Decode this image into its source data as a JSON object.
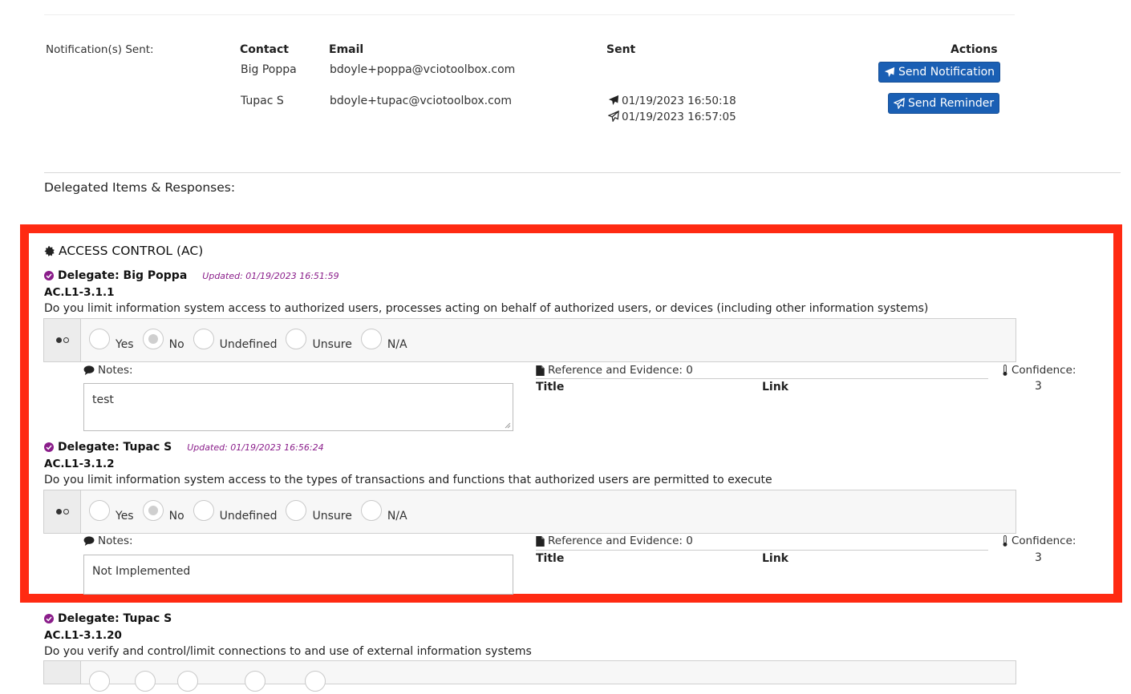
{
  "notifications": {
    "label": "Notification(s) Sent:",
    "headers": {
      "contact": "Contact",
      "email": "Email",
      "sent": "Sent",
      "actions": "Actions"
    },
    "rows": [
      {
        "contact": "Big Poppa",
        "email": "bdoyle+poppa@vciotoolbox.com",
        "sent": [],
        "action": "Send Notification"
      },
      {
        "contact": "Tupac S",
        "email": "bdoyle+tupac@vciotoolbox.com",
        "sent": [
          "01/19/2023 16:50:18",
          "01/19/2023 16:57:05"
        ],
        "action": "Send Reminder"
      }
    ]
  },
  "delegated_title": "Delegated Items & Responses:",
  "category": "ACCESS CONTROL (AC)",
  "options": [
    "Yes",
    "No",
    "Undefined",
    "Unsure",
    "N/A"
  ],
  "labels": {
    "notes": "Notes:",
    "reference": "Reference and Evidence: 0",
    "title_col": "Title",
    "link_col": "Link",
    "confidence": "Confidence:"
  },
  "items": [
    {
      "delegate": "Delegate: Big Poppa",
      "updated": "Updated: 01/19/2023 16:51:59",
      "code": "AC.L1-3.1.1",
      "question": "Do you limit information system access to authorized users, processes acting on behalf of authorized users, or devices (including other information systems)",
      "selected": "No",
      "notes": "test",
      "confidence": "3"
    },
    {
      "delegate": "Delegate: Tupac S",
      "updated": "Updated: 01/19/2023 16:56:24",
      "code": "AC.L1-3.1.2",
      "question": "Do you limit information system access to the types of transactions and functions that authorized users are permitted to execute",
      "selected": "No",
      "notes": "Not Implemented",
      "confidence": "3"
    },
    {
      "delegate": "Delegate: Tupac S",
      "code": "AC.L1-3.1.20",
      "question": "Do you verify and control/limit connections to and use of external information systems"
    }
  ],
  "colors": {
    "button": "#1a5fb4",
    "highlight_border": "#ff2a12",
    "updated_text": "#8a1d8a",
    "check_icon": "#8a1d8a"
  },
  "icons": {
    "send": "paper-plane-icon",
    "reminder": "paper-plane-outline-icon",
    "category": "gear-badge-icon",
    "delegate": "check-circle-icon",
    "notes": "comment-icon",
    "reference": "file-icon",
    "confidence": "thermometer-icon",
    "handle": "radio-toggle-icon"
  }
}
